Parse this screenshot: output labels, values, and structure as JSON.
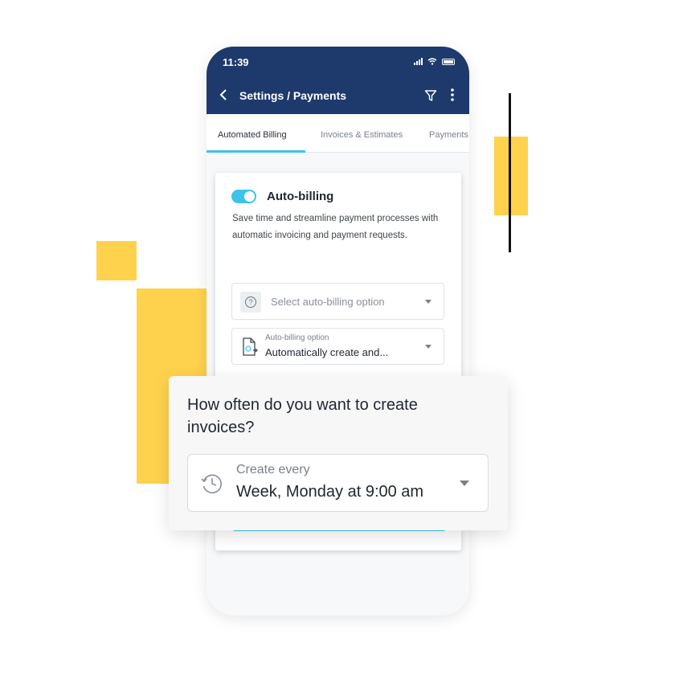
{
  "status": {
    "time": "11:39"
  },
  "appbar": {
    "title": "Settings / Payments",
    "back_icon": "chevron-left-icon",
    "filter_icon": "filter-icon",
    "menu_icon": "kebab-menu-icon"
  },
  "tabs": [
    {
      "label": "Automated Billing",
      "active": true
    },
    {
      "label": "Invoices & Estimates",
      "active": false
    },
    {
      "label": "Payments",
      "active": false
    }
  ],
  "card": {
    "toggle_on": true,
    "title": "Auto-billing",
    "description": "Save time and streamline payment processes with automatic invoicing and payment requests."
  },
  "select_option": {
    "placeholder": "Select auto-billing option"
  },
  "billing_option": {
    "label": "Auto-billing option",
    "value": "Automatically create and..."
  },
  "overlay": {
    "question": "How often do you want to create invoices?",
    "field_label": "Create every",
    "field_value": "Week, Monday at 9:00 am"
  },
  "colors": {
    "appbar": "#1e3a6d",
    "accent": "#3cc4ea",
    "decor_yellow": "#ffd24d"
  }
}
